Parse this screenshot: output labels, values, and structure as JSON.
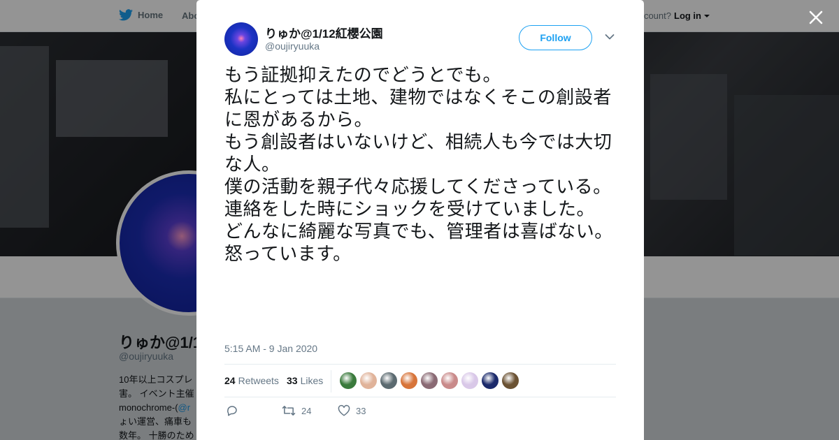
{
  "background": {
    "nav": {
      "home_label": "Home",
      "about_label": "Abo",
      "account_prompt": "ccount?",
      "login_label": "Log in"
    },
    "profile": {
      "name": "りゅか@1/1",
      "handle": "@oujiryuuka",
      "bio_lines": [
        "10年以上コスプレ",
        "害。 イベント主催",
        "monochrome-(",
        "ょい運営、痛車も",
        "数年。 十勝のため"
      ],
      "bio_link": "@r"
    }
  },
  "tweet": {
    "display_name": "りゅか@1/12紅櫻公園",
    "handle": "@oujiryuuka",
    "follow_label": "Follow",
    "text": "もう証拠抑えたのでどうとでも。\n私にとっては土地、建物ではなくそこの創設者に恩があるから。\nもう創設者はいないけど、相続人も今では大切な人。\n僕の活動を親子代々応援してくださっている。\n連絡をした時にショックを受けていました。\nどんなに綺麗な写真でも、管理者は喜ばない。\n怒っています。",
    "timestamp": "5:15 AM - 9 Jan 2020",
    "retweets": {
      "count": "24",
      "label": "Retweets"
    },
    "likes": {
      "count": "33",
      "label": "Likes"
    },
    "actions": {
      "reply": "",
      "retweet_count": "24",
      "like_count": "33"
    },
    "liker_colors": [
      "#3a7a3c",
      "#e0b39a",
      "#5b6a70",
      "#d7743a",
      "#8a6a74",
      "#c98a8a",
      "#d9c8e8",
      "#1b2a6b",
      "#6b5233"
    ]
  },
  "colors": {
    "accent": "#1da1f2",
    "muted_text": "#657786",
    "body_text": "#14171a"
  }
}
